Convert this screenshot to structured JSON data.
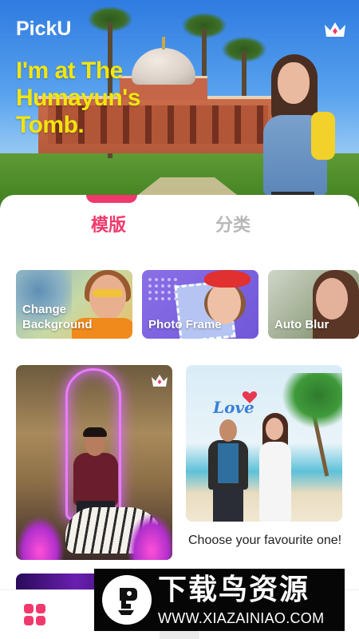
{
  "header": {
    "app_title": "PickU",
    "crown_icon": "crown-icon",
    "banner_caption": "I'm at The Humayun's Tomb."
  },
  "tabs": [
    {
      "label": "模版",
      "active": true
    },
    {
      "label": "分类",
      "active": false
    }
  ],
  "categories": [
    {
      "label": "Change Background"
    },
    {
      "label": "Photo Frame"
    },
    {
      "label": "Auto Blur"
    }
  ],
  "templates": [
    {
      "premium": true,
      "premium_icon": "crown-icon"
    },
    {
      "overlay_text": "Love",
      "caption": "Choose your favourite one!"
    }
  ],
  "bottom_nav": {
    "home_icon": "grid-icon"
  },
  "watermark": {
    "title": "下载鸟资源",
    "url": "WWW.XIAZAINIAO.COM"
  },
  "colors": {
    "accent": "#f03a6d",
    "caption_yellow": "#f3e50d",
    "inactive_tab": "#b8b8b8"
  }
}
